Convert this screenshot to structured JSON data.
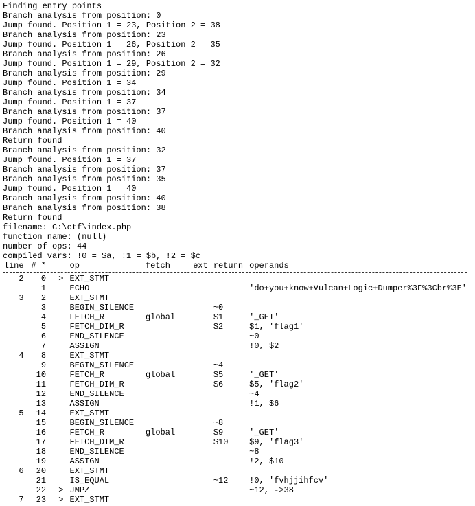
{
  "preamble": [
    "Finding entry points",
    "Branch analysis from position: 0",
    "Jump found. Position 1 = 23, Position 2 = 38",
    "Branch analysis from position: 23",
    "Jump found. Position 1 = 26, Position 2 = 35",
    "Branch analysis from position: 26",
    "Jump found. Position 1 = 29, Position 2 = 32",
    "Branch analysis from position: 29",
    "Jump found. Position 1 = 34",
    "Branch analysis from position: 34",
    "Jump found. Position 1 = 37",
    "Branch analysis from position: 37",
    "Jump found. Position 1 = 40",
    "Branch analysis from position: 40",
    "Return found",
    "Branch analysis from position: 32",
    "Jump found. Position 1 = 37",
    "Branch analysis from position: 37",
    "Branch analysis from position: 35",
    "Jump found. Position 1 = 40",
    "Branch analysis from position: 40",
    "Branch analysis from position: 38",
    "Return found"
  ],
  "meta": {
    "filename_label": "filename:",
    "filename": "C:\\ctf\\index.php",
    "function_label": "function name:",
    "function": "(null)",
    "numops_label": "number of ops:",
    "numops": "44",
    "compiled_label": "compiled vars:",
    "compiled": "!0 = $a, !1 = $b, !2 = $c"
  },
  "header": {
    "line": "line",
    "hash": "# *",
    "op": "op",
    "fetch": "fetch",
    "ext": "ext",
    "return": "return",
    "operands": "operands"
  },
  "rows": [
    {
      "line": "2",
      "hash": "0",
      "star": "",
      "gt": ">",
      "op": "EXT_STMT",
      "fetch": "",
      "ext": "",
      "ret": "",
      "oper": ""
    },
    {
      "line": "",
      "hash": "1",
      "star": "",
      "gt": "",
      "op": "ECHO",
      "fetch": "",
      "ext": "",
      "ret": "",
      "oper": "'do+you+know+Vulcan+Logic+Dumper%3F%3Cbr%3E'"
    },
    {
      "line": "3",
      "hash": "2",
      "star": "",
      "gt": "",
      "op": "EXT_STMT",
      "fetch": "",
      "ext": "",
      "ret": "",
      "oper": ""
    },
    {
      "line": "",
      "hash": "3",
      "star": "",
      "gt": "",
      "op": "BEGIN_SILENCE",
      "fetch": "",
      "ext": "",
      "ret": "~0",
      "oper": ""
    },
    {
      "line": "",
      "hash": "4",
      "star": "",
      "gt": "",
      "op": "FETCH_R",
      "fetch": "global",
      "ext": "",
      "ret": "$1",
      "oper": "'_GET'"
    },
    {
      "line": "",
      "hash": "5",
      "star": "",
      "gt": "",
      "op": "FETCH_DIM_R",
      "fetch": "",
      "ext": "",
      "ret": "$2",
      "oper": "$1, 'flag1'"
    },
    {
      "line": "",
      "hash": "6",
      "star": "",
      "gt": "",
      "op": "END_SILENCE",
      "fetch": "",
      "ext": "",
      "ret": "",
      "oper": "~0"
    },
    {
      "line": "",
      "hash": "7",
      "star": "",
      "gt": "",
      "op": "ASSIGN",
      "fetch": "",
      "ext": "",
      "ret": "",
      "oper": "!0, $2"
    },
    {
      "line": "4",
      "hash": "8",
      "star": "",
      "gt": "",
      "op": "EXT_STMT",
      "fetch": "",
      "ext": "",
      "ret": "",
      "oper": ""
    },
    {
      "line": "",
      "hash": "9",
      "star": "",
      "gt": "",
      "op": "BEGIN_SILENCE",
      "fetch": "",
      "ext": "",
      "ret": "~4",
      "oper": ""
    },
    {
      "line": "",
      "hash": "10",
      "star": "",
      "gt": "",
      "op": "FETCH_R",
      "fetch": "global",
      "ext": "",
      "ret": "$5",
      "oper": "'_GET'"
    },
    {
      "line": "",
      "hash": "11",
      "star": "",
      "gt": "",
      "op": "FETCH_DIM_R",
      "fetch": "",
      "ext": "",
      "ret": "$6",
      "oper": "$5, 'flag2'"
    },
    {
      "line": "",
      "hash": "12",
      "star": "",
      "gt": "",
      "op": "END_SILENCE",
      "fetch": "",
      "ext": "",
      "ret": "",
      "oper": "~4"
    },
    {
      "line": "",
      "hash": "13",
      "star": "",
      "gt": "",
      "op": "ASSIGN",
      "fetch": "",
      "ext": "",
      "ret": "",
      "oper": "!1, $6"
    },
    {
      "line": "5",
      "hash": "14",
      "star": "",
      "gt": "",
      "op": "EXT_STMT",
      "fetch": "",
      "ext": "",
      "ret": "",
      "oper": ""
    },
    {
      "line": "",
      "hash": "15",
      "star": "",
      "gt": "",
      "op": "BEGIN_SILENCE",
      "fetch": "",
      "ext": "",
      "ret": "~8",
      "oper": ""
    },
    {
      "line": "",
      "hash": "16",
      "star": "",
      "gt": "",
      "op": "FETCH_R",
      "fetch": "global",
      "ext": "",
      "ret": "$9",
      "oper": "'_GET'"
    },
    {
      "line": "",
      "hash": "17",
      "star": "",
      "gt": "",
      "op": "FETCH_DIM_R",
      "fetch": "",
      "ext": "",
      "ret": "$10",
      "oper": "$9, 'flag3'"
    },
    {
      "line": "",
      "hash": "18",
      "star": "",
      "gt": "",
      "op": "END_SILENCE",
      "fetch": "",
      "ext": "",
      "ret": "",
      "oper": "~8"
    },
    {
      "line": "",
      "hash": "19",
      "star": "",
      "gt": "",
      "op": "ASSIGN",
      "fetch": "",
      "ext": "",
      "ret": "",
      "oper": "!2, $10"
    },
    {
      "line": "6",
      "hash": "20",
      "star": "",
      "gt": "",
      "op": "EXT_STMT",
      "fetch": "",
      "ext": "",
      "ret": "",
      "oper": ""
    },
    {
      "line": "",
      "hash": "21",
      "star": "",
      "gt": "",
      "op": "IS_EQUAL",
      "fetch": "",
      "ext": "",
      "ret": "~12",
      "oper": "!0, 'fvhjjihfcv'"
    },
    {
      "line": "",
      "hash": "22",
      "star": "",
      "gt": ">",
      "op": "JMPZ",
      "fetch": "",
      "ext": "",
      "ret": "",
      "oper": "~12, ->38",
      "cursor": true
    },
    {
      "line": "7",
      "hash": "23",
      "star": "",
      "gt": ">",
      "op": "EXT_STMT",
      "fetch": "",
      "ext": "",
      "ret": "",
      "oper": ""
    }
  ]
}
